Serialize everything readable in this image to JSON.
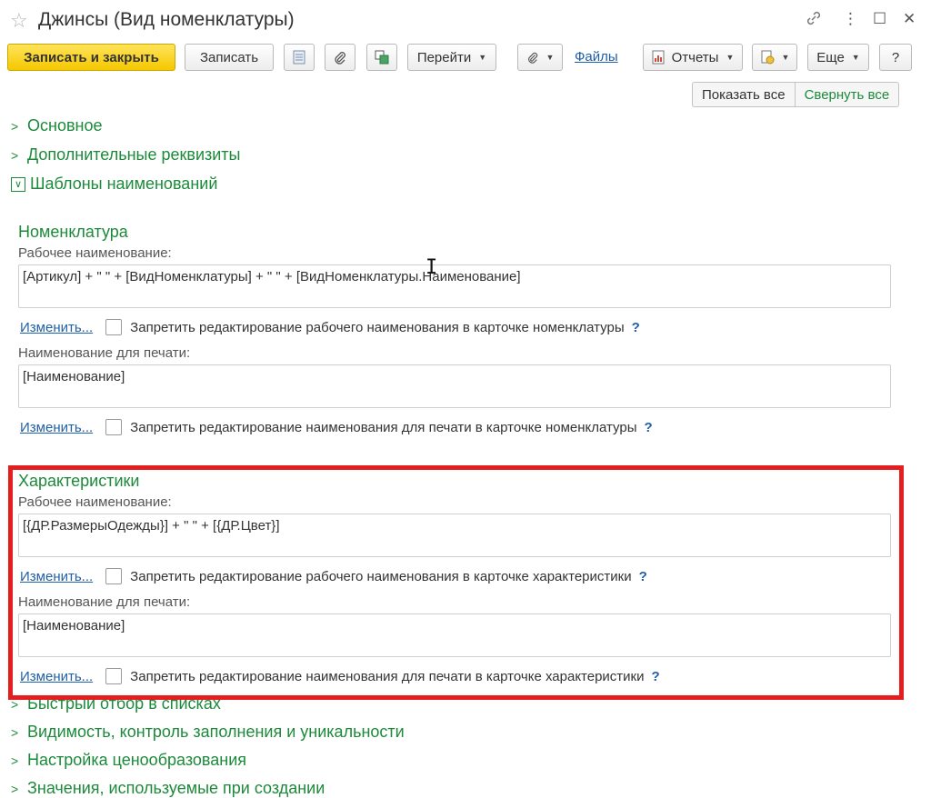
{
  "window": {
    "title": "Джинсы (Вид номенклатуры)",
    "icons": [
      "star-icon",
      "link-icon",
      "more-icon",
      "maximize-icon",
      "close-icon"
    ]
  },
  "toolbar": {
    "save_close": "Записать и закрыть",
    "save": "Записать",
    "goto": "Перейти",
    "files": "Файлы",
    "reports": "Отчеты",
    "more": "Еще",
    "help": "?"
  },
  "view": {
    "show_all": "Показать все",
    "collapse_all": "Свернуть все"
  },
  "groups": {
    "main": "Основное",
    "extra": "Дополнительные реквизиты",
    "templates": "Шаблоны наименований",
    "quick_filter": "Быстрый отбор в списках",
    "visibility": "Видимость, контроль заполнения и уникальности",
    "pricing": "Настройка ценообразования",
    "values": "Значения, используемые при создании"
  },
  "nomenclature": {
    "header": "Номенклатура",
    "work_label": "Рабочее наименование:",
    "work_value": "[Артикул] + \" \" + [ВидНоменклатуры] + \" \" + [ВидНоменклатуры.Наименование]",
    "edit1": "Изменить...",
    "forbid_work": "Запретить редактирование рабочего наименования в карточке номенклатуры",
    "print_label": "Наименование для печати:",
    "print_value": "[Наименование]",
    "edit2": "Изменить...",
    "forbid_print": "Запретить редактирование наименования для печати в карточке номенклатуры"
  },
  "characteristics": {
    "header": "Характеристики",
    "work_label": "Рабочее наименование:",
    "work_value": "[{ДР.РазмерыОдежды}] + \" \" + [{ДР.Цвет}]",
    "edit1": "Изменить...",
    "forbid_work": "Запретить редактирование рабочего наименования в карточке характеристики",
    "print_label": "Наименование для печати:",
    "print_value": "[Наименование]",
    "edit2": "Изменить...",
    "forbid_print": "Запретить редактирование наименования для печати в карточке характеристики"
  },
  "help_mark": "?",
  "colors": {
    "accent": "#1c8a3a",
    "link": "#1f5fa8",
    "highlight": "#e41e1e",
    "primary": "#f5c800"
  }
}
